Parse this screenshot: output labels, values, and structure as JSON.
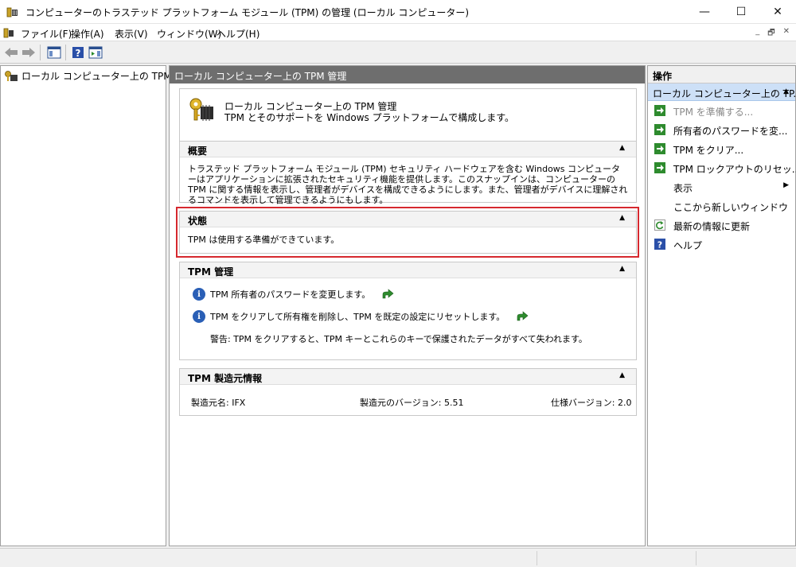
{
  "window": {
    "title": "コンピューターのトラステッド プラットフォーム モジュール (TPM) の管理 (ローカル コンピューター)",
    "minimize": "—",
    "maximize": "☐",
    "close": "✕"
  },
  "menu": {
    "items": [
      "ファイル(F)",
      "操作(A)",
      "表示(V)",
      "ウィンドウ(W)",
      "ヘルプ(H)"
    ],
    "mdi": [
      "_",
      "🗗",
      "✕"
    ]
  },
  "tree": {
    "root_label": "ローカル コンピューター上の TPM 管理"
  },
  "center": {
    "header": "ローカル コンピューター上の TPM 管理",
    "intro_title": "ローカル コンピューター上の TPM 管理",
    "intro_subtitle": "TPM とそのサポートを Windows プラットフォームで構成します。",
    "overview": {
      "heading": "概要",
      "text": "トラステッド プラットフォーム モジュール (TPM) セキュリティ ハードウェアを含む Windows コンピューターはアプリケーションに拡張されたセキュリティ機能を提供します。このスナップインは、コンピューターの TPM に関する情報を表示し、管理者がデバイスを構成できるようにします。また、管理者がデバイスに理解されるコマンドを表示して管理できるようにもします。"
    },
    "status": {
      "heading": "状態",
      "text": "TPM は使用する準備ができています。"
    },
    "management": {
      "heading": "TPM 管理",
      "change_password": "TPM 所有者のパスワードを変更します。",
      "clear_tpm": "TPM をクリアして所有権を削除し、TPM を既定の設定にリセットします。",
      "warning": "警告: TPM をクリアすると、TPM キーとこれらのキーで保護されたデータがすべて失われます。"
    },
    "manufacturer": {
      "heading": "TPM 製造元情報",
      "name": "製造元名: IFX",
      "version": "製造元のバージョン: 5.51",
      "spec": "仕様バージョン: 2.0"
    }
  },
  "actions": {
    "title": "操作",
    "group": "ローカル コンピューター上の TP...",
    "items": [
      "TPM を準備する...",
      "所有者のパスワードを変...",
      "TPM をクリア...",
      "TPM ロックアウトのリセッ...",
      "表示",
      "ここから新しいウィンドウ",
      "最新の情報に更新",
      "ヘルプ"
    ]
  },
  "colors": {
    "header_bg": "#6e6e6e",
    "group_bg": "#cde0f7",
    "highlight": "#d6282e",
    "action_green": "#2e8b2e",
    "info_blue": "#2a5fb6"
  }
}
